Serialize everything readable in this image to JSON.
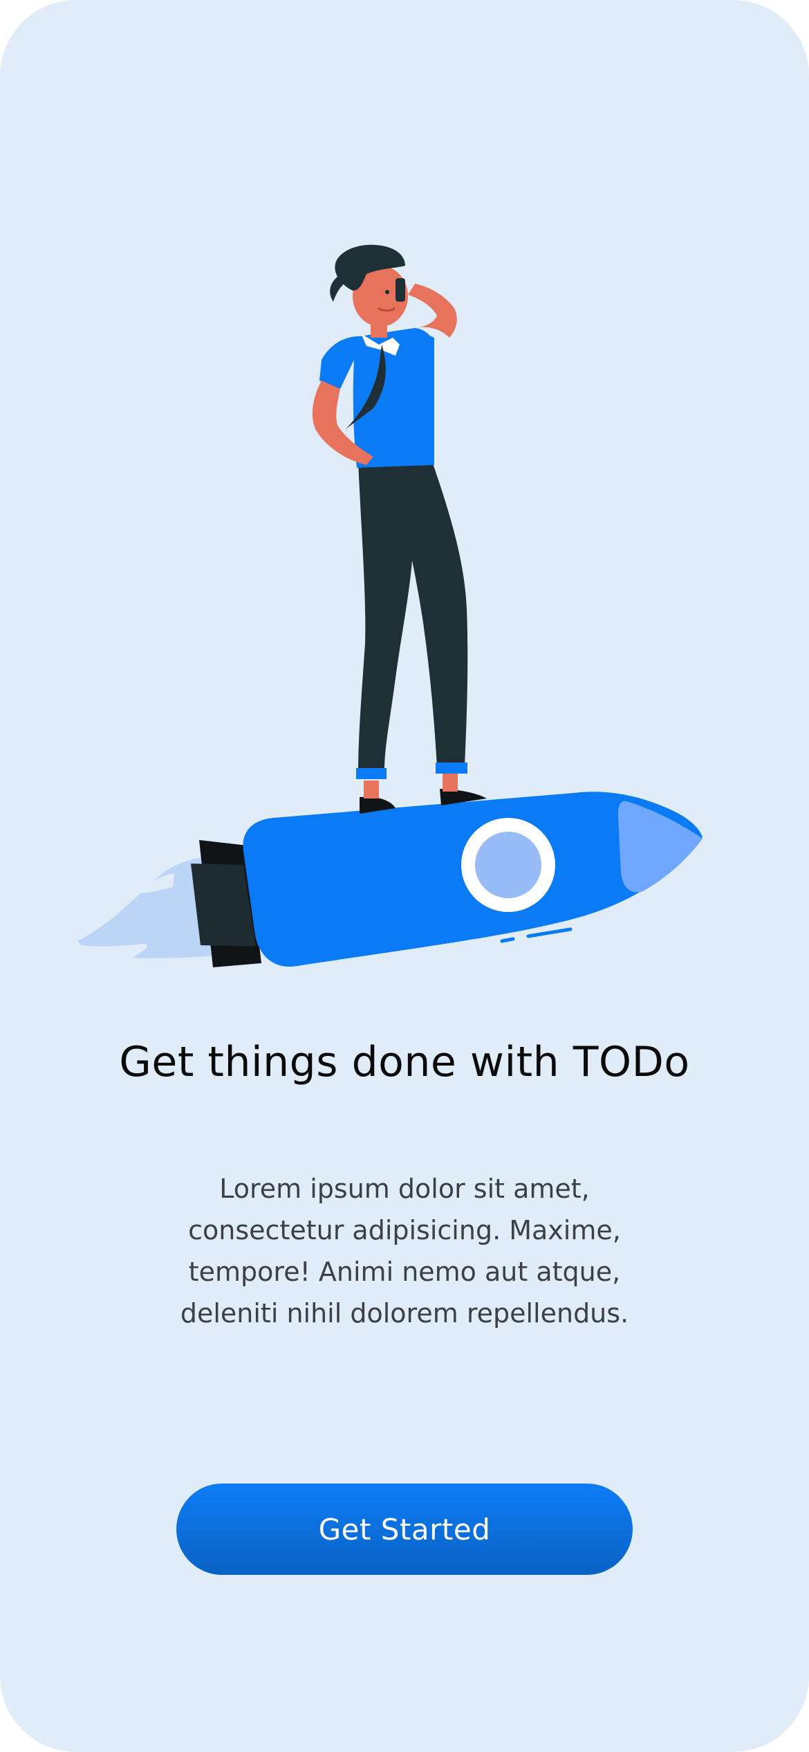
{
  "onboarding": {
    "title": "Get things done with TODo",
    "description": "Lorem ipsum dolor sit amet, consectetur adipisicing. Maxime, tempore! Animi nemo aut atque, deleniti nihil dolorem repellendus.",
    "cta_label": "Get Started"
  },
  "colors": {
    "background": "#e1ecf9",
    "accent": "#0a7af5",
    "button_gradient_top": "#0d7df5",
    "button_gradient_bottom": "#0a62c4",
    "title_text": "#0b0b0b",
    "body_text": "#3b3f46"
  },
  "illustration": {
    "icon": "person-riding-rocket-illustration"
  }
}
